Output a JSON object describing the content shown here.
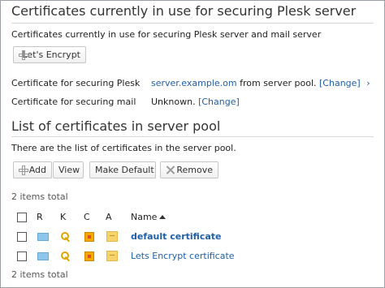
{
  "section1": {
    "title": "Certificates currently in use for securing Plesk server",
    "description": "Certificates currently in use for securing Plesk server and mail server",
    "letsencrypt_label": "Let's Encrypt",
    "plesk_label": "Certificate for securing Plesk",
    "plesk_value_link": "server.example.om",
    "plesk_value_text": " from server pool. ",
    "plesk_change": "[Change]",
    "plesk_trailing": "›",
    "mail_label": "Certificate for securing mail",
    "mail_value_text": "Unknown. ",
    "mail_change": "[Change]"
  },
  "section2": {
    "title": "List of certificates in server pool",
    "description": "There are the list of certificates in the server pool.",
    "toolbar": {
      "add_label": "Add",
      "view_label": "View",
      "make_default_label": "Make Default",
      "remove_label": "Remove"
    },
    "items_total_top": "2 items total",
    "items_total_bottom": "2 items total",
    "columns": {
      "r": "R",
      "k": "K",
      "c": "C",
      "a": "A",
      "name": "Name"
    },
    "rows": [
      {
        "name": "default certificate"
      },
      {
        "name": "Lets Encrypt certificate"
      }
    ]
  },
  "icons": {
    "mail": "envelope-icon",
    "key": "key-icon",
    "cert": "certificate-icon",
    "ca": "note-icon",
    "plus": "plus-icon",
    "remove": "remove-icon",
    "sort": "sort-ascending-icon"
  },
  "colors": {
    "link": "#1f5fa8",
    "envelope": "#8ec5ea",
    "key": "#e0a400",
    "certificate": "#f2a900",
    "note": "#f6d36b"
  }
}
